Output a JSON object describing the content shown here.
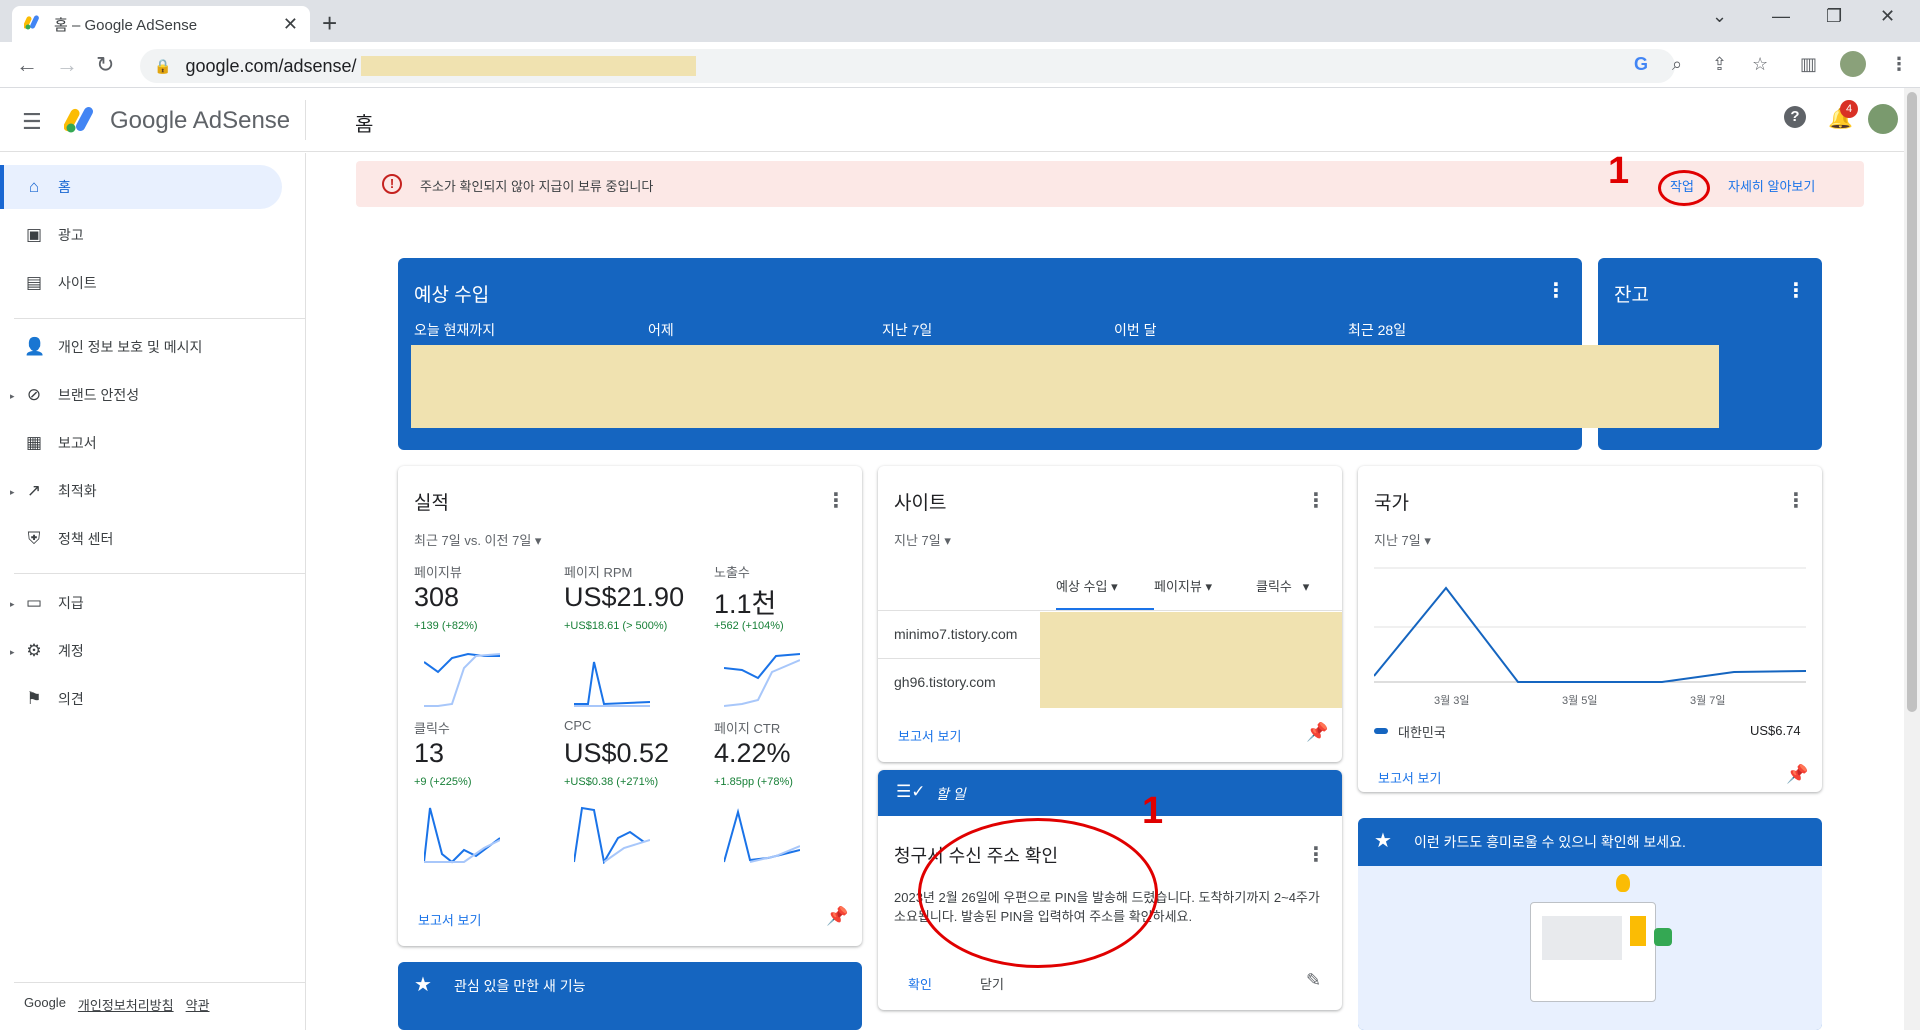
{
  "browser": {
    "tab_title": "홈 – Google AdSense",
    "url": "google.com/adsense/"
  },
  "app": {
    "brand": "Google AdSense",
    "page_title": "홈",
    "notification_count": "4"
  },
  "sidebar": {
    "items": [
      {
        "label": "홈",
        "icon": "home-icon"
      },
      {
        "label": "광고",
        "icon": "ads-icon"
      },
      {
        "label": "사이트",
        "icon": "sites-icon"
      },
      {
        "label": "개인 정보 보호 및 메시지",
        "icon": "privacy-icon"
      },
      {
        "label": "브랜드 안전성",
        "icon": "block-icon"
      },
      {
        "label": "보고서",
        "icon": "reports-icon"
      },
      {
        "label": "최적화",
        "icon": "trending-icon"
      },
      {
        "label": "정책 센터",
        "icon": "shield-icon"
      },
      {
        "label": "지급",
        "icon": "payments-icon"
      },
      {
        "label": "계정",
        "icon": "gear-icon"
      },
      {
        "label": "의견",
        "icon": "feedback-icon"
      }
    ],
    "footer": {
      "google": "Google",
      "privacy": "개인정보처리방침",
      "terms": "약관"
    }
  },
  "alert": {
    "message": "주소가 확인되지 않아 지급이 보류 중입니다",
    "action": "작업",
    "learn_more": "자세히 알아보기"
  },
  "annotations": {
    "one": "1"
  },
  "earnings": {
    "title": "예상 수입",
    "columns": [
      "오늘 현재까지",
      "어제",
      "지난 7일",
      "이번 달",
      "최근 28일"
    ]
  },
  "balance": {
    "title": "잔고"
  },
  "performance": {
    "title": "실적",
    "range": "최근 7일 vs. 이전 7일",
    "metrics": [
      {
        "label": "페이지뷰",
        "value": "308",
        "delta": "+139 (+82%)"
      },
      {
        "label": "페이지 RPM",
        "value": "US$21.90",
        "delta": "+US$18.61 (> 500%)"
      },
      {
        "label": "노출수",
        "value": "1.1천",
        "delta": "+562 (+104%)"
      },
      {
        "label": "클릭수",
        "value": "13",
        "delta": "+9 (+225%)"
      },
      {
        "label": "CPC",
        "value": "US$0.52",
        "delta": "+US$0.38 (+271%)"
      },
      {
        "label": "페이지 CTR",
        "value": "4.22%",
        "delta": "+1.85pp (+78%)"
      }
    ],
    "report_link": "보고서 보기"
  },
  "sites": {
    "title": "사이트",
    "range": "지난 7일",
    "tabs": [
      "예상 수입",
      "페이지뷰",
      "클릭수"
    ],
    "rows": [
      "minimo7.tistory.com",
      "gh96.tistory.com"
    ],
    "report_link": "보고서 보기"
  },
  "countries": {
    "title": "국가",
    "range": "지난 7일",
    "x_labels": [
      "3월 3일",
      "3월 5일",
      "3월 7일"
    ],
    "legend_country": "대한민국",
    "legend_value": "US$6.74",
    "report_link": "보고서 보기",
    "accent": "#1565c0"
  },
  "todo": {
    "header": "할 일",
    "title": "청구서 수신 주소 확인",
    "body": "2023년 2월 26일에 우편으로 PIN을 발송해 드렸습니다. 도착하기까지 2~4주가 소요됩니다. 발송된 PIN을 입력하여 주소를 확인하세요.",
    "confirm": "확인",
    "close": "닫기"
  },
  "interesting_cards": {
    "title": "이런 카드도 흥미로울 수 있으니 확인해 보세요."
  },
  "new_features": {
    "title": "관심 있을 만한 새 기능"
  }
}
